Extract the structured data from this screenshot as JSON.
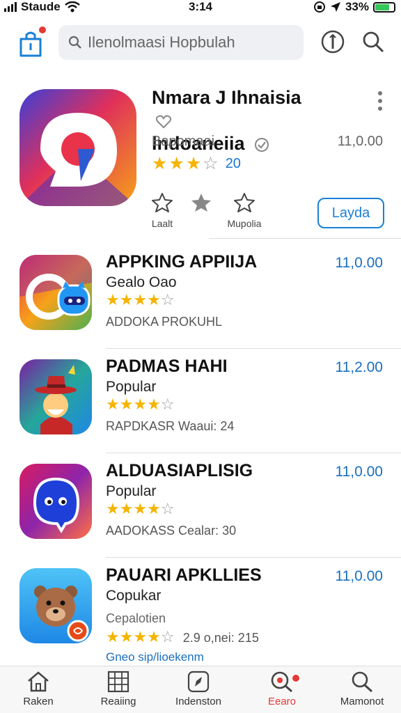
{
  "status_bar": {
    "carrier": "Staude",
    "time": "3:14",
    "battery_percent": "33%",
    "battery_level": 0.7
  },
  "header": {
    "search_placeholder": "Ilenolmaasi Hopbulah",
    "bag_icon": "shopping-bag-icon",
    "badge_color": "#e53935"
  },
  "featured": {
    "title_line1": "Nmara J Ihnaisia",
    "title_line2": "Indoaneiia",
    "subtitle": "Bapomaai",
    "price": "11,0.00",
    "rating": 3,
    "rating_count": "20",
    "action1_label": "Laalt",
    "action2_label": "Mupolia",
    "get_label": "Layda"
  },
  "apps": [
    {
      "title": "APPKING APPIIJA",
      "subtitle": "Gealo Oao",
      "rating": 4,
      "meta": "ADDOKA PROKUHL",
      "price": "11,0.00"
    },
    {
      "title": "PADMAS HAHI",
      "subtitle": "Popular",
      "rating": 4,
      "meta": "RAPDKASR Waaui: 24",
      "price": "11,2.00"
    },
    {
      "title": "ALDUASIAPLISIG",
      "subtitle": "Popular",
      "rating": 4,
      "meta": "AADOKASS Cealar: 30",
      "price": "11,0.00"
    },
    {
      "title": "PAUARI APKLLIES",
      "subtitle": "Copukar",
      "subtitle2": "Cepalotien",
      "rating": 4,
      "rating_text": "2.9 o,nei: 215",
      "meta": "",
      "price": "11,0.00"
    }
  ],
  "partial_row_text": "Gneo sip/lioekenm",
  "tabs": [
    {
      "label": "Raken",
      "icon": "home-icon"
    },
    {
      "label": "Reaiing",
      "icon": "grid-icon"
    },
    {
      "label": "Indenston",
      "icon": "compass-icon"
    },
    {
      "label": "Eearo",
      "icon": "search-badge-icon",
      "active": true
    },
    {
      "label": "Mamonot",
      "icon": "search-icon"
    }
  ],
  "colors": {
    "accent": "#1a7fd6",
    "price": "#1a6fc0",
    "star": "#f4b400",
    "active_tab": "#e53935"
  }
}
